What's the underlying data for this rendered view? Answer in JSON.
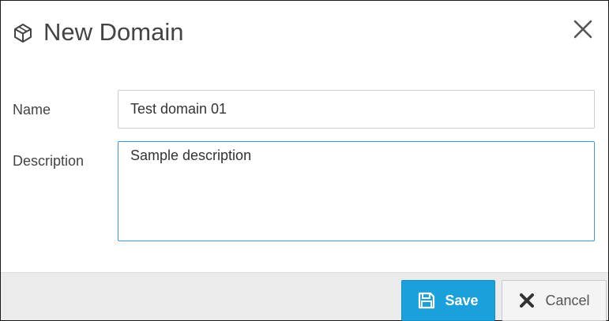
{
  "dialog": {
    "title": "New Domain",
    "title_icon": "domain-cube-icon",
    "close_icon": "close-icon"
  },
  "form": {
    "name_label": "Name",
    "name_value": "Test domain 01",
    "description_label": "Description",
    "description_value": "Sample description"
  },
  "footer": {
    "save_label": "Save",
    "save_icon": "floppy-disk-icon",
    "cancel_label": "Cancel",
    "cancel_icon": "x-icon"
  },
  "colors": {
    "primary": "#1aa0db",
    "focus_border": "#3a9ad9",
    "footer_bg": "#ebebeb",
    "text": "#444444"
  }
}
